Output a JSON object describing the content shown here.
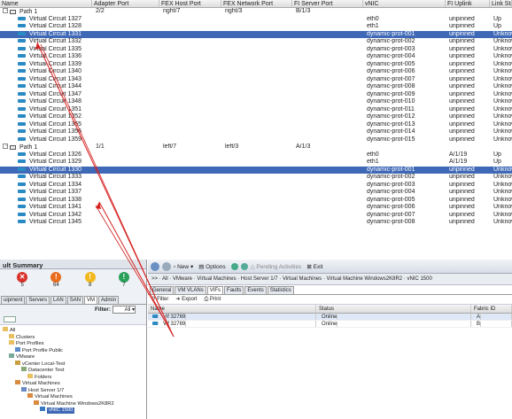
{
  "columns": [
    "Name",
    "Adapter Port",
    "FEX Host Port",
    "FEX Network Port",
    "FI Server Port",
    "vNIC",
    "FI Uplink",
    "Link State"
  ],
  "paths": [
    {
      "name": "Path 1",
      "adapter_port": "2/2",
      "fex_host_port": "right/7",
      "fex_network_port": "right/3",
      "fi_server_port": "B/1/3",
      "circuits": [
        {
          "name": "Virtual Circuit 1327",
          "vnic": "eth0",
          "uplink": "unpinned",
          "state": "Up",
          "selected": false
        },
        {
          "name": "Virtual Circuit 1328",
          "vnic": "eth1",
          "uplink": "unpinned",
          "state": "Up",
          "selected": false
        },
        {
          "name": "Virtual Circuit 1331",
          "vnic": "dynamic-prot-001",
          "uplink": "unpinned",
          "state": "Unknown",
          "selected": true
        },
        {
          "name": "Virtual Circuit 1332",
          "vnic": "dynamic-prot-002",
          "uplink": "unpinned",
          "state": "Unknown",
          "selected": false
        },
        {
          "name": "Virtual Circuit 1335",
          "vnic": "dynamic-prot-003",
          "uplink": "unpinned",
          "state": "Unknown",
          "selected": false
        },
        {
          "name": "Virtual Circuit 1336",
          "vnic": "dynamic-prot-004",
          "uplink": "unpinned",
          "state": "Unknown",
          "selected": false
        },
        {
          "name": "Virtual Circuit 1339",
          "vnic": "dynamic-prot-005",
          "uplink": "unpinned",
          "state": "Unknown",
          "selected": false
        },
        {
          "name": "Virtual Circuit 1340",
          "vnic": "dynamic-prot-006",
          "uplink": "unpinned",
          "state": "Unknown",
          "selected": false
        },
        {
          "name": "Virtual Circuit 1343",
          "vnic": "dynamic-prot-007",
          "uplink": "unpinned",
          "state": "Unknown",
          "selected": false
        },
        {
          "name": "Virtual Circuit 1344",
          "vnic": "dynamic-prot-008",
          "uplink": "unpinned",
          "state": "Unknown",
          "selected": false
        },
        {
          "name": "Virtual Circuit 1347",
          "vnic": "dynamic-prot-009",
          "uplink": "unpinned",
          "state": "Unknown",
          "selected": false
        },
        {
          "name": "Virtual Circuit 1348",
          "vnic": "dynamic-prot-010",
          "uplink": "unpinned",
          "state": "Unknown",
          "selected": false
        },
        {
          "name": "Virtual Circuit 1351",
          "vnic": "dynamic-prot-011",
          "uplink": "unpinned",
          "state": "Unknown",
          "selected": false
        },
        {
          "name": "Virtual Circuit 1352",
          "vnic": "dynamic-prot-012",
          "uplink": "unpinned",
          "state": "Unknown",
          "selected": false
        },
        {
          "name": "Virtual Circuit 1355",
          "vnic": "dynamic-prot-013",
          "uplink": "unpinned",
          "state": "Unknown",
          "selected": false
        },
        {
          "name": "Virtual Circuit 1356",
          "vnic": "dynamic-prot-014",
          "uplink": "unpinned",
          "state": "Unknown",
          "selected": false
        },
        {
          "name": "Virtual Circuit 1359",
          "vnic": "dynamic-prot-015",
          "uplink": "unpinned",
          "state": "Unknown",
          "selected": false
        }
      ]
    },
    {
      "name": "Path 1",
      "adapter_port": "1/1",
      "fex_host_port": "left/7",
      "fex_network_port": "left/3",
      "fi_server_port": "A/1/3",
      "circuits": [
        {
          "name": "Virtual Circuit 1326",
          "vnic": "eth0",
          "uplink": "A/1/19",
          "state": "Up",
          "selected": false
        },
        {
          "name": "Virtual Circuit 1329",
          "vnic": "eth1",
          "uplink": "A/1/19",
          "state": "Up",
          "selected": false
        },
        {
          "name": "Virtual Circuit 1330",
          "vnic": "dynamic-prot-001",
          "uplink": "unpinned",
          "state": "Unknown",
          "selected": true
        },
        {
          "name": "Virtual Circuit 1333",
          "vnic": "dynamic-prot-002",
          "uplink": "unpinned",
          "state": "Unknown",
          "selected": false
        },
        {
          "name": "Virtual Circuit 1334",
          "vnic": "dynamic-prot-003",
          "uplink": "unpinned",
          "state": "Unknown",
          "selected": false
        },
        {
          "name": "Virtual Circuit 1337",
          "vnic": "dynamic-prot-004",
          "uplink": "unpinned",
          "state": "Unknown",
          "selected": false
        },
        {
          "name": "Virtual Circuit 1338",
          "vnic": "dynamic-prot-005",
          "uplink": "unpinned",
          "state": "Unknown",
          "selected": false
        },
        {
          "name": "Virtual Circuit 1341",
          "vnic": "dynamic-prot-006",
          "uplink": "unpinned",
          "state": "Unknown",
          "selected": false
        },
        {
          "name": "Virtual Circuit 1342",
          "vnic": "dynamic-prot-007",
          "uplink": "unpinned",
          "state": "Unknown",
          "selected": false
        },
        {
          "name": "Virtual Circuit 1345",
          "vnic": "dynamic-prot-008",
          "uplink": "unpinned",
          "state": "Unknown",
          "selected": false
        }
      ]
    }
  ],
  "fault_panel": {
    "title": "ult Summary",
    "severities": [
      {
        "count": "5",
        "icon": "critical-x-icon",
        "color": "#d9302a"
      },
      {
        "count": "64",
        "icon": "major-triangle-icon",
        "color": "#e86c1c"
      },
      {
        "count": "8",
        "icon": "minor-triangle-icon",
        "color": "#f2b81c"
      },
      {
        "count": "7",
        "icon": "warning-triangle-icon",
        "color": "#2aa05a"
      }
    ],
    "tabs": [
      "uipment",
      "Servers",
      "LAN",
      "SAN",
      "VM",
      "Admin"
    ],
    "active_tab": "VM",
    "filter_label": "Filter:",
    "filter_value": "All",
    "tree": [
      {
        "label": "All",
        "indent": 0,
        "icon": "folder-icon"
      },
      {
        "label": "Clusters",
        "indent": 1,
        "icon": "folder-icon"
      },
      {
        "label": "Port Profiles",
        "indent": 1,
        "icon": "folder-icon"
      },
      {
        "label": "Port Profile Public",
        "indent": 2,
        "icon": "profile-icon"
      },
      {
        "label": "VMware",
        "indent": 1,
        "icon": "vmware-icon"
      },
      {
        "label": "vCenter Local-Test",
        "indent": 2,
        "icon": "vcenter-icon"
      },
      {
        "label": "Datacenter Test",
        "indent": 3,
        "icon": "datacenter-icon"
      },
      {
        "label": "Folders",
        "indent": 4,
        "icon": "folder-icon"
      },
      {
        "label": "Virtual Machines",
        "indent": 2,
        "icon": "vm-icon"
      },
      {
        "label": "Host Server 1/7",
        "indent": 3,
        "icon": "server-icon"
      },
      {
        "label": "Virtual Machines",
        "indent": 4,
        "icon": "vm-icon"
      },
      {
        "label": "Virtual Machine Windows2K8R2",
        "indent": 5,
        "icon": "vm-icon"
      },
      {
        "label": "vNIC 1500",
        "indent": 6,
        "icon": "vnic-icon",
        "selected": true
      }
    ]
  },
  "vm_panel": {
    "toolbar": {
      "new": "New",
      "options": "Options",
      "pending": "Pending Activities",
      "exit": "Exit"
    },
    "breadcrumb": ">> · All · VMware · Virtual Machines · Host Server 1/7 · Virtual Machines · Virtual Machine Windows2K8R2 · vNIC 1500",
    "tabs": [
      "General",
      "VM VLANs",
      "VIFs",
      "Faults",
      "Events",
      "Statistics"
    ],
    "active_tab": "VIFs",
    "actions": [
      "Filter",
      "Export",
      "Print"
    ],
    "columns": [
      "Name",
      "Status",
      "Fabric ID"
    ],
    "rows": [
      {
        "name": "Vif 32769",
        "status": "Online",
        "fabric": "A"
      },
      {
        "name": "Vif 32769",
        "status": "Online",
        "fabric": "B"
      }
    ]
  }
}
